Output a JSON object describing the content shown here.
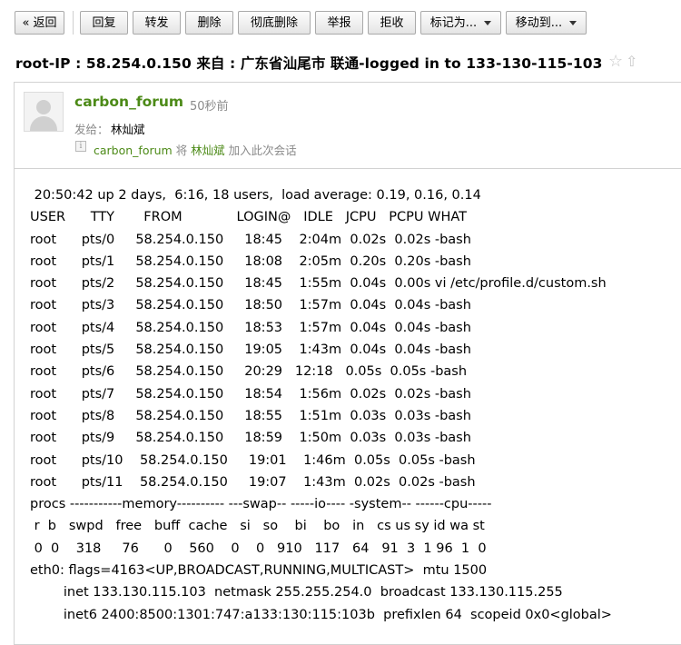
{
  "toolbar": {
    "back": "« 返回",
    "reply": "回复",
    "forward": "转发",
    "delete": "删除",
    "delete_forever": "彻底删除",
    "report": "举报",
    "reject": "拒收",
    "mark_as": "标记为...",
    "move_to": "移动到..."
  },
  "subject": "root-IP : 58.254.0.150 来自 : 广东省汕尾市 联通-logged in to 133-130-115-103",
  "icons": {
    "star": "star-icon",
    "share": "share-icon",
    "avatar": "avatar-placeholder",
    "info": "info-icon"
  },
  "header": {
    "sender": "carbon_forum",
    "time": "50秒前",
    "to_label": "发给：",
    "to_name": "林灿斌",
    "conv_sender": "carbon_forum",
    "conv_mid": " 将 ",
    "conv_name": "林灿斌",
    "conv_tail": " 加入此次会话"
  },
  "colors": {
    "sender_green": "#4c8a17",
    "muted_gray": "#8a8a8a",
    "border": "#d2d2d2"
  },
  "body_lines": [
    " 20:50:42 up 2 days,  6:16, 18 users,  load average: 0.19, 0.16, 0.14",
    "USER      TTY       FROM             LOGIN@   IDLE   JCPU   PCPU WHAT",
    "root      pts/0     58.254.0.150     18:45    2:04m  0.02s  0.02s -bash",
    "root      pts/1     58.254.0.150     18:08    2:05m  0.20s  0.20s -bash",
    "root      pts/2     58.254.0.150     18:45    1:55m  0.04s  0.00s vi /etc/profile.d/custom.sh",
    "root      pts/3     58.254.0.150     18:50    1:57m  0.04s  0.04s -bash",
    "root      pts/4     58.254.0.150     18:53    1:57m  0.04s  0.04s -bash",
    "root      pts/5     58.254.0.150     19:05    1:43m  0.04s  0.04s -bash",
    "root      pts/6     58.254.0.150     20:29   12:18   0.05s  0.05s -bash",
    "root      pts/7     58.254.0.150     18:54    1:56m  0.02s  0.02s -bash",
    "root      pts/8     58.254.0.150     18:55    1:51m  0.03s  0.03s -bash",
    "root      pts/9     58.254.0.150     18:59    1:50m  0.03s  0.03s -bash",
    "root      pts/10    58.254.0.150     19:01    1:46m  0.05s  0.05s -bash",
    "root      pts/11    58.254.0.150     19:07    1:43m  0.02s  0.02s -bash",
    "procs -----------memory---------- ---swap-- -----io---- -system-- ------cpu-----",
    " r  b   swpd   free   buff  cache   si   so    bi    bo   in   cs us sy id wa st",
    " 0  0    318     76      0    560    0    0   910   117   64   91  3  1 96  1  0",
    "eth0: flags=4163<UP,BROADCAST,RUNNING,MULTICAST>  mtu 1500",
    "        inet 133.130.115.103  netmask 255.255.254.0  broadcast 133.130.115.255",
    "        inet6 2400:8500:1301:747:a133:130:115:103b  prefixlen 64  scopeid 0x0<global>"
  ]
}
